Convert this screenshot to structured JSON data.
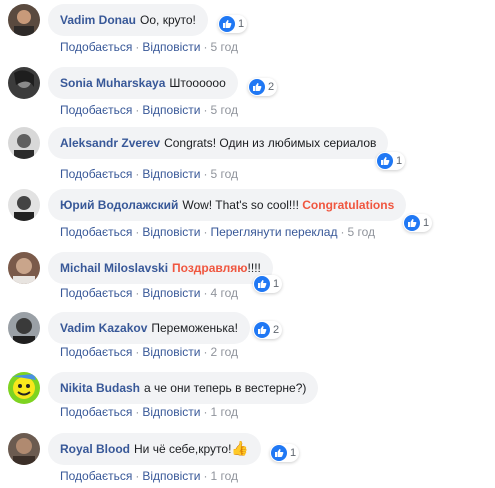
{
  "comments": [
    {
      "author": "Vadim Donau",
      "text": "Оо, круто!",
      "highlight": "",
      "suffix": "",
      "likes": "1",
      "actions": [
        "Подобається",
        "Відповісти"
      ],
      "time": "5 год"
    },
    {
      "author": "Sonia Muharskaya",
      "text": "Штоооооо",
      "highlight": "",
      "suffix": "",
      "likes": "2",
      "actions": [
        "Подобається",
        "Відповісти"
      ],
      "time": "5 год"
    },
    {
      "author": "Aleksandr Zverev",
      "text": "Congrats! Один из любимых сериалов",
      "highlight": "",
      "suffix": "",
      "likes": "1",
      "actions": [
        "Подобається",
        "Відповісти"
      ],
      "time": "5 год"
    },
    {
      "author": "Юрий Водолажский",
      "text": "Wow! That's so cool!!! ",
      "highlight": "Congratulations",
      "suffix": "",
      "likes": "1",
      "actions": [
        "Подобається",
        "Відповісти",
        "Переглянути переклад"
      ],
      "time": "5 год"
    },
    {
      "author": "Michail Miloslavski",
      "text": "",
      "highlight": "Поздравляю",
      "suffix": "!!!!",
      "likes": "1",
      "actions": [
        "Подобається",
        "Відповісти"
      ],
      "time": "4 год"
    },
    {
      "author": "Vadim Kazakov",
      "text": "Переможенька!",
      "highlight": "",
      "suffix": "",
      "likes": "2",
      "actions": [
        "Подобається",
        "Відповісти"
      ],
      "time": "2 год"
    },
    {
      "author": "Nikita Budash",
      "text": "а че они теперь в вестерне?)",
      "highlight": "",
      "suffix": "",
      "likes": "",
      "actions": [
        "Подобається",
        "Відповісти"
      ],
      "time": "1 год"
    },
    {
      "author": "Royal Blood",
      "text": "Ни чё себе,круто!",
      "highlight": "",
      "suffix": "",
      "emoji": "👍",
      "likes": "1",
      "actions": [
        "Подобається",
        "Відповісти"
      ],
      "time": "1 год"
    }
  ],
  "colors": {
    "author": "#385898",
    "highlight": "#f0563f",
    "like": "#2078f4",
    "bubble": "#f2f3f5",
    "meta": "#90949c"
  },
  "icons": {
    "like": "thumbs-up-icon"
  }
}
